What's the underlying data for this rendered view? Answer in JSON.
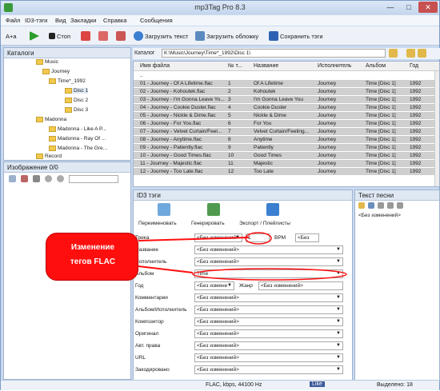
{
  "window": {
    "title": "mp3Tag Pro 8.3",
    "min": "—",
    "max": "□",
    "close": "✕"
  },
  "menu": [
    "Файл",
    "ID3-тэги",
    "Вид",
    "Закладки",
    "Справка",
    "Сообщения"
  ],
  "toolbar": {
    "play": "Старт",
    "stop": "Стоп",
    "load_text": "Загрузить текст",
    "load_cover": "Загрузить обложку",
    "save_tags": "Сохранить тэги",
    "font": "A+a"
  },
  "catalogs": {
    "title": "Каталоги",
    "items": [
      "Music",
      "Journey",
      "Time*_1992",
      "Disc 1",
      "Disc 2",
      "Disc 3",
      "Madonna",
      "Madonna - Like A P...",
      "Madonna - Ray Of ...",
      "Madonna - The Gre...",
      "Record"
    ]
  },
  "path": {
    "label": "Каталог",
    "value": "K:\\Music\\Journey\\Time*_1992\\Disc 1\\"
  },
  "grid": {
    "headers": [
      "Имя файла",
      "№ т...",
      "Название",
      "Исполнитель",
      "Альбом",
      "Год"
    ],
    "rows": [
      [
        "..",
        "",
        "",
        "",
        "",
        ""
      ],
      [
        "01 - Journey - Of A Lifetime.flac",
        "1",
        "Of A Lifetime",
        "Journey",
        "Time [Disc 1]",
        "1992"
      ],
      [
        "02 - Journey - Kohoutek.flac",
        "2",
        "Kohoutek",
        "Journey",
        "Time [Disc 1]",
        "1992"
      ],
      [
        "03 - Journey - I'm Gonna Leave Yo...",
        "3",
        "I'm Gonna Leave You",
        "Journey",
        "Time [Disc 1]",
        "1992"
      ],
      [
        "04 - Journey - Cookie Duster.flac",
        "4",
        "Cookie Duster",
        "Journey",
        "Time [Disc 1]",
        "1992"
      ],
      [
        "05 - Journey - Nickle & Dime.flac",
        "5",
        "Nickle & Dime",
        "Journey",
        "Time [Disc 1]",
        "1992"
      ],
      [
        "06 - Journey - For You.flac",
        "6",
        "For You",
        "Journey",
        "Time [Disc 1]",
        "1992"
      ],
      [
        "07 - Journey - Velvet Curtain/Feel...",
        "7",
        "Velvet Curtain/Feeling...",
        "Journey",
        "Time [Disc 1]",
        "1992"
      ],
      [
        "08 - Journey - Anytime.flac",
        "8",
        "Anytime",
        "Journey",
        "Time [Disc 1]",
        "1992"
      ],
      [
        "09 - Journey - Patiently.flac",
        "9",
        "Patiently",
        "Journey",
        "Time [Disc 1]",
        "1992"
      ],
      [
        "10 - Journey - Good Times.flac",
        "10",
        "Good Times",
        "Journey",
        "Time [Disc 1]",
        "1992"
      ],
      [
        "11 - Journey - Majestic.flac",
        "11",
        "Majestic",
        "Journey",
        "Time [Disc 1]",
        "1992"
      ],
      [
        "12 - Journey - Too Late.flac",
        "12",
        "Too Late",
        "Journey",
        "Time [Disc 1]",
        "1992"
      ]
    ]
  },
  "image_panel": {
    "title": "Изображение 0/0"
  },
  "id3": {
    "title": "ID3 тэги",
    "rename": "Переименовать",
    "generate": "Генерировать",
    "export": "Экспорт / Плейлисты",
    "track_label": "Трека",
    "track_value": "1",
    "bpm": "BPM",
    "no_change_short": "<Без",
    "fields": [
      {
        "label": "Трека",
        "value": "<Без изменений>"
      },
      {
        "label": "Название",
        "value": "<Без изменений>"
      },
      {
        "label": "Исполнитель",
        "value": "<Без изменений>"
      },
      {
        "label": "Альбом",
        "value": "Time"
      },
      {
        "label": "Год",
        "value": "<Без измене"
      },
      {
        "label": "Комментарии",
        "value": "<Без изменений>"
      },
      {
        "label": "Альбом/Исполнитель",
        "value": "<Без изменений>"
      },
      {
        "label": "Композитор",
        "value": "<Без изменений>"
      },
      {
        "label": "Оригинал",
        "value": "<Без изменений>"
      },
      {
        "label": "Авт. права",
        "value": "<Без изменений>"
      },
      {
        "label": "URL",
        "value": "<Без изменений>"
      },
      {
        "label": "Закодировано",
        "value": "<Без изменений>"
      }
    ],
    "genre": "Жанр",
    "genre_value": "<Без изменений>"
  },
  "lyrics": {
    "title": "Текст песни",
    "value": "<Без изменений>"
  },
  "callout": {
    "line1": "Изменение",
    "line2": "тегов FLAC"
  },
  "status": {
    "format": "FLAC,  kbps, 44100 Hz",
    "like": "Like",
    "selected": "Выделено: 18"
  }
}
